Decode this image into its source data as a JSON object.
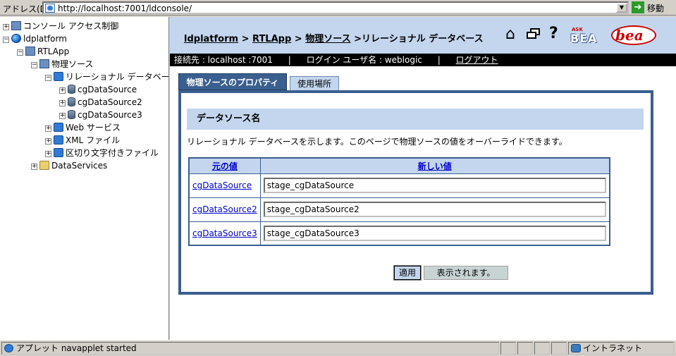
{
  "address_bar": {
    "label": "アドレス(D)",
    "url": "http://localhost:7001/ldconsole/",
    "go_label": "移動"
  },
  "tree": {
    "items": [
      {
        "label": "コンソール アクセス制御",
        "toggle": "+",
        "icon": "console-access-icon"
      },
      {
        "label": "ldplatform",
        "toggle": "−",
        "icon": "globe-icon"
      },
      {
        "label": "RTLApp",
        "toggle": "−",
        "icon": "application-icon"
      },
      {
        "label": "物理ソース",
        "toggle": "−",
        "icon": "physical-source-icon"
      },
      {
        "label": "リレーショナル データベー",
        "toggle": "−",
        "icon": "relational-db-folder-icon"
      },
      {
        "label": "cgDataSource",
        "toggle": "+",
        "icon": "database-icon"
      },
      {
        "label": "cgDataSource2",
        "toggle": "+",
        "icon": "database-icon"
      },
      {
        "label": "cgDataSource3",
        "toggle": "+",
        "icon": "database-icon"
      },
      {
        "label": "Web サービス",
        "toggle": "+",
        "icon": "web-service-icon"
      },
      {
        "label": "XML ファイル",
        "toggle": "+",
        "icon": "xml-file-icon"
      },
      {
        "label": "区切り文字付きファイル",
        "toggle": "+",
        "icon": "delimited-file-icon"
      },
      {
        "label": "DataServices",
        "toggle": "+",
        "icon": "folder-icon"
      }
    ]
  },
  "header": {
    "crumb_1": "ldplatform",
    "sep_1": " > ",
    "crumb_2": "RTLApp",
    "sep_2": " > ",
    "crumb_3": "物理ソース",
    "crumb_current": " >リレーショナル データベース",
    "ask_label": "ASK",
    "bea_label": "BEA",
    "logo_text": "bea"
  },
  "session": {
    "connection": "接続先 :  localhost :7001",
    "sep": "|",
    "user": "ログイン ユーザ名 :  weblogic",
    "logout": "ログアウト"
  },
  "tabs": {
    "properties": "物理ソースのプロパティ",
    "usage": "使用場所"
  },
  "panel": {
    "section_title": "データソース名",
    "description": "リレーショナル データベースを示します。このページで物理ソースの値をオーバーライドできます。",
    "col_original": "元の値",
    "col_new": "新しい値",
    "rows": [
      {
        "original": "cgDataSource",
        "new_value": "stage_cgDataSource"
      },
      {
        "original": "cgDataSource2",
        "new_value": "stage_cgDataSource2"
      },
      {
        "original": "cgDataSource3",
        "new_value": "stage_cgDataSource3"
      }
    ],
    "apply_label": "適用",
    "shown_label": "表示されます。"
  },
  "statusbar": {
    "text": "アプレット navapplet started",
    "zone": "イントラネット"
  }
}
